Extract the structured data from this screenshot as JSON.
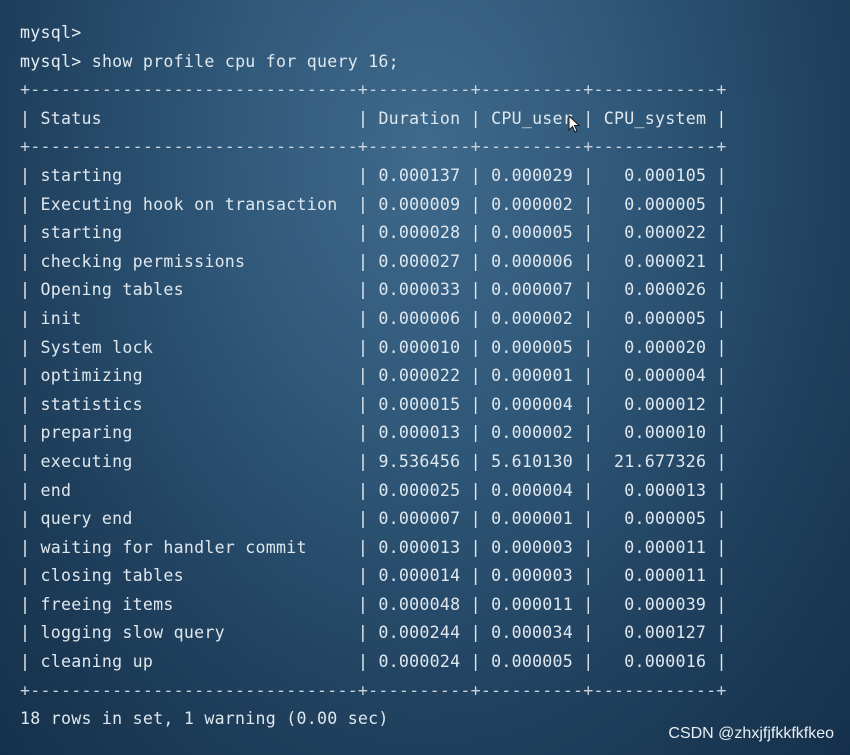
{
  "terminal": {
    "prompt": "mysql>",
    "command": "show profile cpu for query 16;",
    "columns": [
      "Status",
      "Duration",
      "CPU_user",
      "CPU_system"
    ],
    "rows": [
      [
        "starting",
        "0.000137",
        "0.000029",
        "0.000105"
      ],
      [
        "Executing hook on transaction",
        "0.000009",
        "0.000002",
        "0.000005"
      ],
      [
        "starting",
        "0.000028",
        "0.000005",
        "0.000022"
      ],
      [
        "checking permissions",
        "0.000027",
        "0.000006",
        "0.000021"
      ],
      [
        "Opening tables",
        "0.000033",
        "0.000007",
        "0.000026"
      ],
      [
        "init",
        "0.000006",
        "0.000002",
        "0.000005"
      ],
      [
        "System lock",
        "0.000010",
        "0.000005",
        "0.000020"
      ],
      [
        "optimizing",
        "0.000022",
        "0.000001",
        "0.000004"
      ],
      [
        "statistics",
        "0.000015",
        "0.000004",
        "0.000012"
      ],
      [
        "preparing",
        "0.000013",
        "0.000002",
        "0.000010"
      ],
      [
        "executing",
        "9.536456",
        "5.610130",
        "21.677326"
      ],
      [
        "end",
        "0.000025",
        "0.000004",
        "0.000013"
      ],
      [
        "query end",
        "0.000007",
        "0.000001",
        "0.000005"
      ],
      [
        "waiting for handler commit",
        "0.000013",
        "0.000003",
        "0.000011"
      ],
      [
        "closing tables",
        "0.000014",
        "0.000003",
        "0.000011"
      ],
      [
        "freeing items",
        "0.000048",
        "0.000011",
        "0.000039"
      ],
      [
        "logging slow query",
        "0.000244",
        "0.000034",
        "0.000127"
      ],
      [
        "cleaning up",
        "0.000024",
        "0.000005",
        "0.000016"
      ]
    ],
    "result_summary": "18 rows in set, 1 warning (0.00 sec)"
  },
  "watermark": "CSDN @zhxjfjfkkfkfkeo",
  "colors": {
    "text": "#dfe7ee",
    "background": "#2f5778"
  }
}
